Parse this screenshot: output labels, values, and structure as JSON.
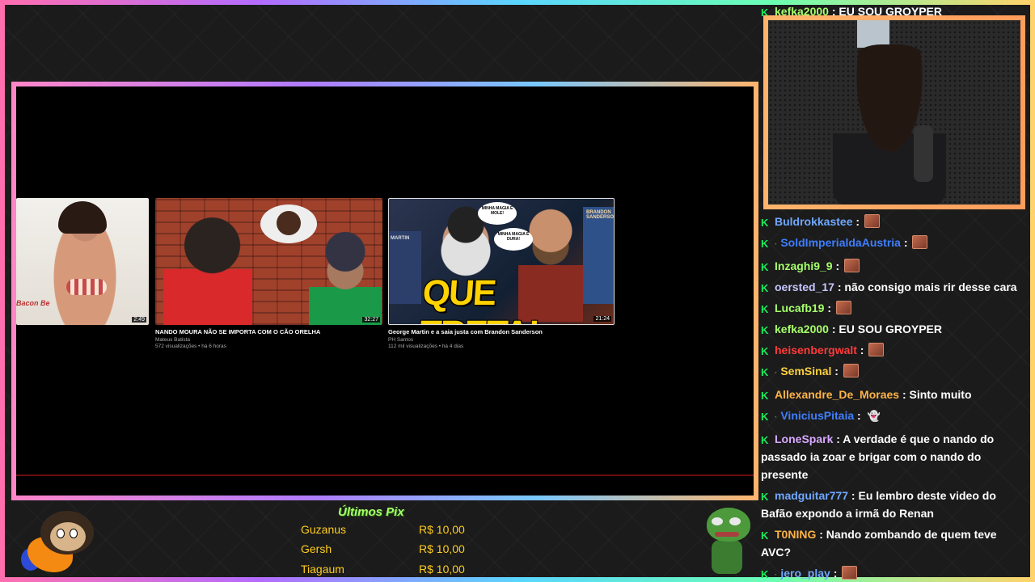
{
  "chat_top": {
    "name": "kefka2000",
    "name_color": "#a6ff6a",
    "text": "EU SOU GROYPER"
  },
  "videos": [
    {
      "title": "",
      "channel": "",
      "meta": "",
      "duration": "2:49",
      "label": "Bacon Be"
    },
    {
      "title": "NANDO MOURA NÃO SE IMPORTA COM O CÃO ORELHA",
      "channel": "Mateus Batista",
      "meta": "572 visualizações • há 6 horas",
      "duration": "32:27"
    },
    {
      "title": "George Martin e a saia justa com Brandon Sanderson",
      "channel": "PH Santos",
      "meta": "112 mil visualizações • há 4 dias",
      "duration": "21:24",
      "bubble1": "MINHA MAGIA É MOLE!",
      "bubble2": "MINHA MAGIA É DURA!",
      "big_text": "QUE TRETA!",
      "book_right": "BRANDON SANDERSON",
      "book_left": "MARTIN"
    }
  ],
  "chat": [
    {
      "name": "Buldrokkastee",
      "color": "#6fa8ff",
      "text": "",
      "emote": true,
      "sub": false
    },
    {
      "name": "SoldImperialdaAustria",
      "color": "#3f7fff",
      "text": "",
      "emote": true,
      "sub": true
    },
    {
      "name": "Inzaghi9_9",
      "color": "#a6ff6a",
      "text": "",
      "emote": true,
      "sub": false
    },
    {
      "name": "oersted_17",
      "color": "#c6c6ff",
      "text": "não consigo mais rir desse cara",
      "emote": false,
      "sub": false
    },
    {
      "name": "Lucafb19",
      "color": "#a6ff6a",
      "text": "",
      "emote": true,
      "sub": false
    },
    {
      "name": "kefka2000",
      "color": "#a6ff6a",
      "text": "EU SOU GROYPER",
      "emote": false,
      "sub": false
    },
    {
      "name": "heisenbergwalt",
      "color": "#ff3b3b",
      "text": "",
      "emote": true,
      "sub": false
    },
    {
      "name": "SemSinal",
      "color": "#ffd23f",
      "text": "",
      "emote": true,
      "sub": true
    },
    {
      "name": "Allexandre_De_Moraes",
      "color": "#ffb347",
      "text": "Sinto muito",
      "emote": false,
      "sub": false
    },
    {
      "name": "ViniciusPitaia",
      "color": "#3f7fff",
      "text": "",
      "emote": false,
      "ghost": true,
      "sub": true
    },
    {
      "name": "LoneSpark",
      "color": "#d9a8ff",
      "text": "A verdade é que o nando do passado ia zoar e brigar com o nando do presente",
      "emote": false,
      "sub": false
    },
    {
      "name": "madguitar777",
      "color": "#6fa8ff",
      "text": "Eu lembro deste video do Bafão expondo a irmã do Renan",
      "emote": false,
      "sub": false
    },
    {
      "name": "T0NING",
      "color": "#ffb347",
      "text": "Nando zombando de quem teve AVC?",
      "emote": false,
      "sub": false
    },
    {
      "name": "jero_play",
      "color": "#6fa8ff",
      "text": "",
      "emote": true,
      "sub": true
    }
  ],
  "donations": {
    "title": "Últimos Pix",
    "rows": [
      {
        "name": "Guzanus",
        "amount": "R$ 10,00"
      },
      {
        "name": "Gersh",
        "amount": "R$ 10,00"
      },
      {
        "name": "Tiagaum",
        "amount": "R$ 10,00"
      }
    ]
  },
  "colors": {
    "badge": "#1aeb5a",
    "donation": "#ffcd1e",
    "donation_title": "#a6ff6a"
  }
}
